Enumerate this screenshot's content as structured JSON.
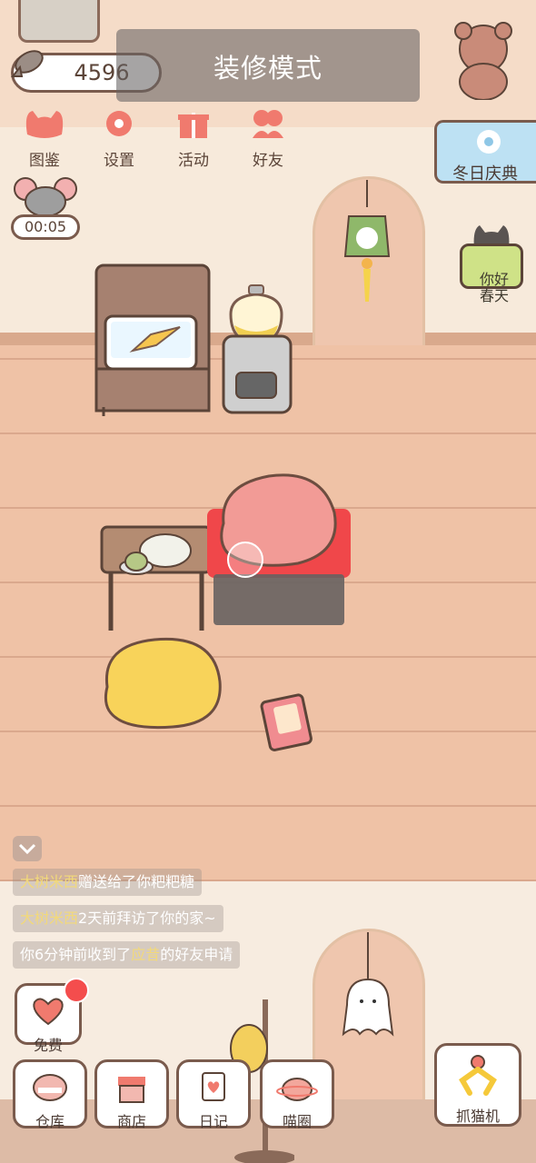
{
  "currency": {
    "fish_count": "4596"
  },
  "mode_banner": {
    "title": "装修模式"
  },
  "top_nav": {
    "items": [
      {
        "label": "图鉴",
        "icon": "cat-face-icon"
      },
      {
        "label": "设置",
        "icon": "gear-icon"
      },
      {
        "label": "活动",
        "icon": "gift-icon"
      },
      {
        "label": "好友",
        "icon": "friends-icon"
      }
    ]
  },
  "timer": {
    "value": "00:05"
  },
  "events": {
    "winter_label": "冬日庆典",
    "spring_label": "你好\n春天"
  },
  "feed": {
    "lines": [
      {
        "name": "大树米西",
        "text": "赠送给了你粑粑糖"
      },
      {
        "name": "大树米西",
        "text": "2天前拜访了你的家~"
      },
      {
        "prefix": "你6分钟前收到了",
        "name": "应昔",
        "suffix": "的好友申请"
      }
    ]
  },
  "free_button": {
    "label": "免费",
    "icon": "heart-gift-icon"
  },
  "bottom_nav": {
    "items": [
      {
        "label": "仓库",
        "icon": "storage-icon"
      },
      {
        "label": "商店",
        "icon": "shop-icon"
      },
      {
        "label": "日记",
        "icon": "diary-icon"
      },
      {
        "label": "喵圈",
        "icon": "cat-planet-icon"
      }
    ]
  },
  "claw_machine": {
    "label": "抓猫机",
    "icon": "claw-icon"
  },
  "colors": {
    "floor": "#efc2a6",
    "wall": "#f7eadb",
    "accent_selected": "#f0474a",
    "banner_overlay": "#666262"
  }
}
